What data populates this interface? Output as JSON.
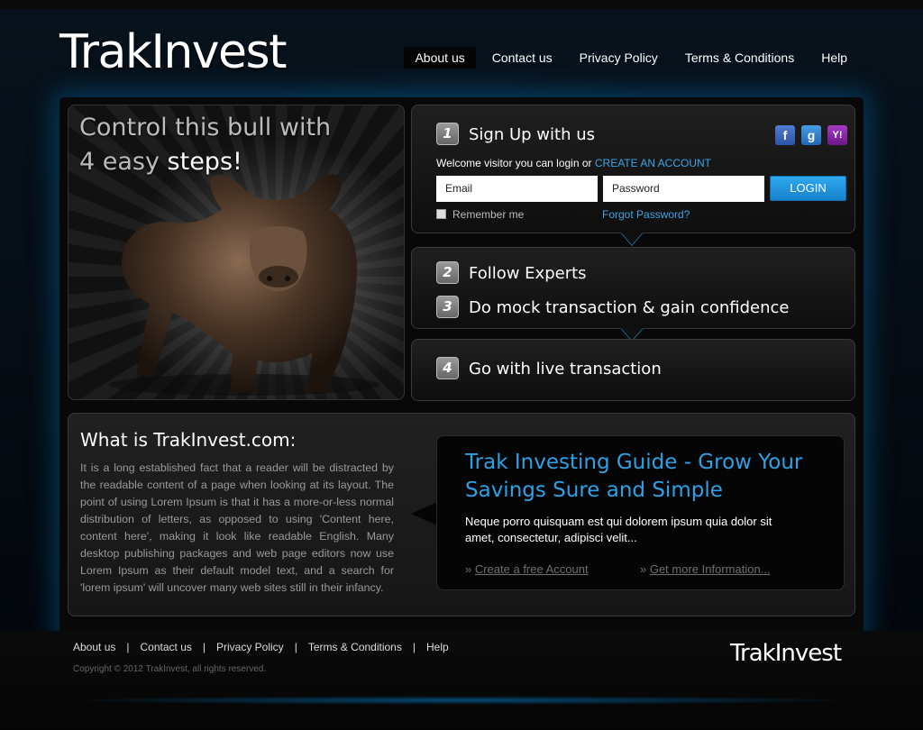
{
  "header": {
    "logo": "TrakInvest",
    "nav": [
      "About us",
      "Contact us",
      "Privacy Policy",
      "Terms & Conditions",
      "Help"
    ],
    "active_nav": "About us"
  },
  "hero": {
    "line1": "Control this bull with",
    "line2_prefix": "4 easy ",
    "line2_suffix": "steps!"
  },
  "signup": {
    "step_number": "1",
    "title": "Sign Up with us",
    "welcome": "Welcome visitor you can login or ",
    "create_account": "CREATE AN ACCOUNT",
    "email_placeholder": "Email",
    "password_placeholder": "Password",
    "login_label": "LOGIN",
    "remember_label": "Remember me",
    "forgot_label": "Forgot Password?",
    "social": {
      "facebook": "f",
      "google": "g",
      "yahoo": "Y!"
    }
  },
  "steps": [
    {
      "number": "2",
      "title": "Follow Experts"
    },
    {
      "number": "3",
      "title": "Do mock transaction & gain confidence"
    },
    {
      "number": "4",
      "title": "Go with live transaction"
    }
  ],
  "about": {
    "title": "What is TrakInvest.com:",
    "text": "It is a long established fact that a reader will be distracted by the readable content of a page when looking at its layout. The point of using Lorem Ipsum is that it has a more-or-less normal distribution of letters, as opposed to using 'Content here, content here', making it look like readable English. Many desktop publishing packages and web page editors now use Lorem Ipsum as their default model text, and a search for 'lorem ipsum' will uncover many web sites still in their infancy."
  },
  "guide": {
    "title": "Trak Investing Guide - Grow Your Savings Sure and Simple",
    "text": "Neque porro quisquam est qui dolorem ipsum quia dolor sit amet, consectetur, adipisci velit...",
    "link1": "Create a free Account",
    "link2": "Get more Information...",
    "link_prefix": "» "
  },
  "footer": {
    "nav": [
      "About us",
      "Contact us",
      "Privacy Policy",
      "Terms & Conditions",
      "Help"
    ],
    "separator": "|",
    "copyright": "Copyright © 2012 TrakInvest, all rights reserved.",
    "logo": "TrakInvest"
  },
  "colors": {
    "accent": "#2ea0e6",
    "link": "#3aa4e8",
    "login_button": "#1f8fd8",
    "facebook": "#3b5998",
    "google": "#2f7ad0",
    "yahoo": "#7b1fa2"
  },
  "icons": [
    "bull-image",
    "facebook-icon",
    "google-icon",
    "yahoo-icon",
    "checkbox-icon"
  ]
}
